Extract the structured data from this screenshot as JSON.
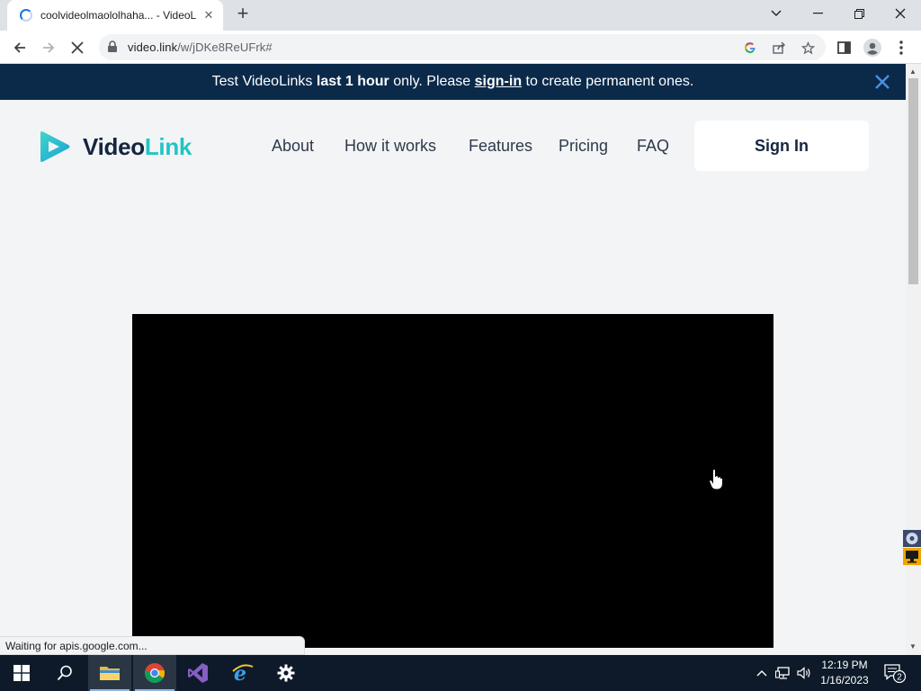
{
  "browser": {
    "tab_title": "coolvideolmaololhaha... - VideoL",
    "new_tab_label": "+",
    "url_host": "video.link",
    "url_path": "/w/jDKe8ReUFrk#",
    "status_text": "Waiting for apis.google.com..."
  },
  "banner": {
    "text_1": "Test VideoLinks ",
    "text_bold": "last 1 hour",
    "text_2": " only. Please ",
    "link": "sign-in",
    "text_3": " to create permanent ones."
  },
  "header": {
    "logo_part1": "Video",
    "logo_part2": "Link",
    "nav": [
      "About",
      "How it works",
      "Features",
      "Pricing",
      "FAQ"
    ],
    "signin_label": "Sign In"
  },
  "taskbar": {
    "time": "12:19 PM",
    "date": "1/16/2023",
    "notification_count": "2"
  },
  "colors": {
    "banner_bg": "#0b2a4a",
    "brand_teal": "#22c4c4",
    "brand_navy": "#15263e",
    "taskbar_bg": "#0e1a29"
  },
  "icons": [
    "spinner-icon",
    "close-icon",
    "back-icon",
    "forward-icon",
    "stop-icon",
    "lock-icon",
    "google-icon",
    "share-icon",
    "star-icon",
    "side-panel-icon",
    "profile-icon",
    "menu-icon",
    "windows-start-icon",
    "search-icon",
    "file-explorer-icon",
    "chrome-icon",
    "visual-studio-icon",
    "internet-explorer-icon",
    "settings-icon",
    "chevron-up-icon",
    "network-icon",
    "volume-icon",
    "notification-icon"
  ]
}
